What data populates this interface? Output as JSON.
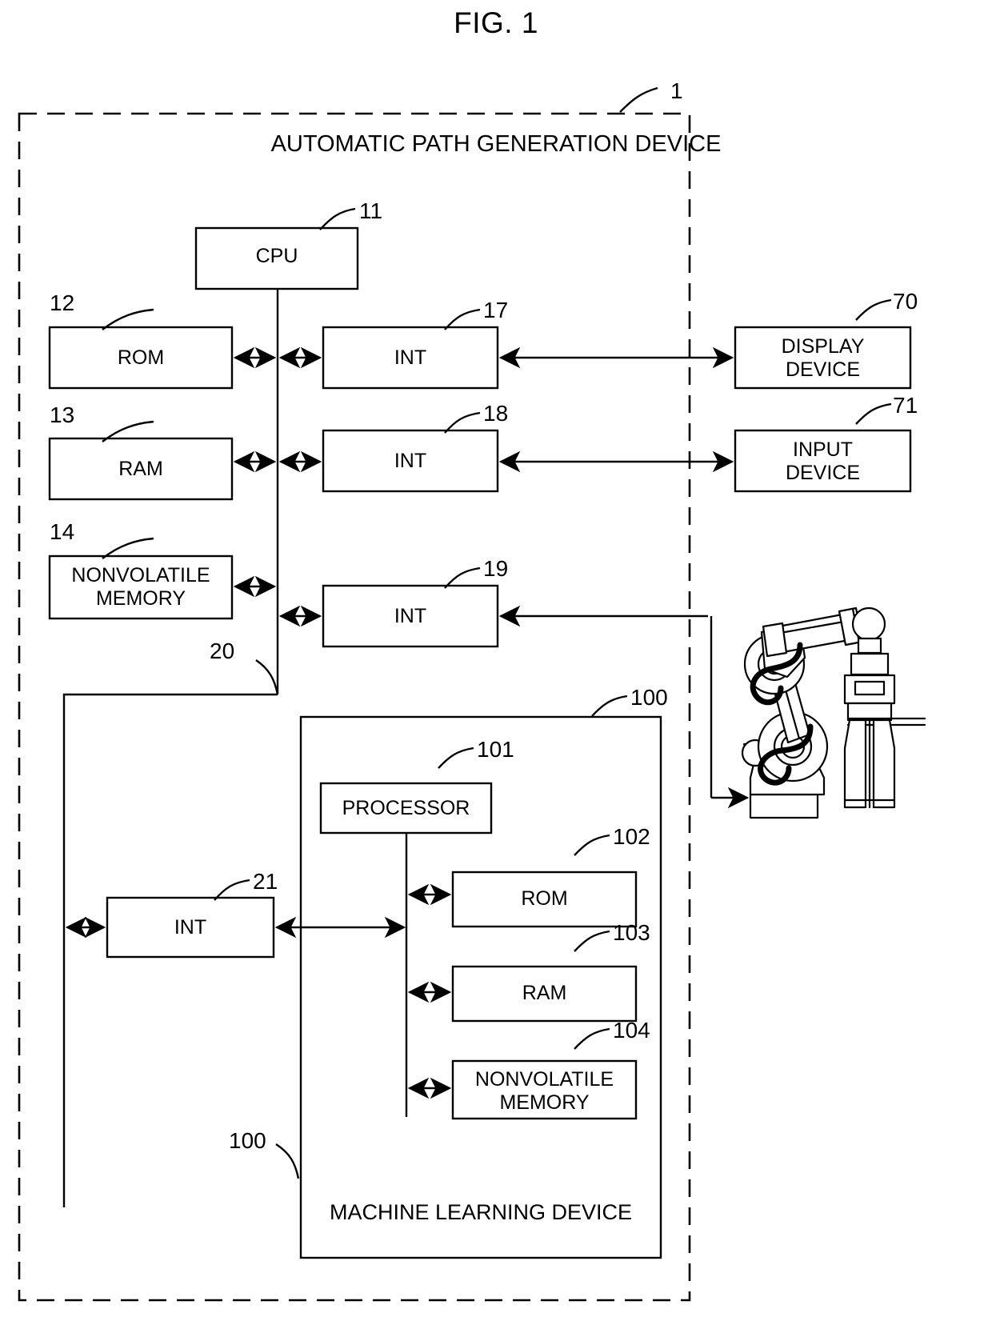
{
  "figure": {
    "title": "FIG. 1",
    "outer_label": "AUTOMATIC PATH GENERATION DEVICE",
    "outer_ref": "1",
    "ml_label": "MACHINE LEARNING DEVICE",
    "ml_ref_top": "100",
    "ml_ref_bottom": "100",
    "bus_ref_main": "20",
    "line_color": "#000000",
    "background": "#ffffff"
  },
  "blocks": {
    "cpu": {
      "label": "CPU",
      "ref": "11"
    },
    "rom": {
      "label": "ROM",
      "ref": "12"
    },
    "ram": {
      "label": "RAM",
      "ref": "13"
    },
    "nvram": {
      "label": "NONVOLATILE\nMEMORY",
      "ref": "14"
    },
    "int17": {
      "label": "INT",
      "ref": "17"
    },
    "int18": {
      "label": "INT",
      "ref": "18"
    },
    "int19": {
      "label": "INT",
      "ref": "19"
    },
    "int21": {
      "label": "INT",
      "ref": "21"
    },
    "display_device": {
      "label": "DISPLAY\nDEVICE",
      "ref": "70"
    },
    "input_device": {
      "label": "INPUT\nDEVICE",
      "ref": "71"
    },
    "processor": {
      "label": "PROCESSOR",
      "ref": "101"
    },
    "ml_rom": {
      "label": "ROM",
      "ref": "102"
    },
    "ml_ram": {
      "label": "RAM",
      "ref": "103"
    },
    "ml_nvram": {
      "label": "NONVOLATILE\nMEMORY",
      "ref": "104"
    }
  },
  "robot": {
    "name": "industrial-robot-arm-with-gripper"
  }
}
